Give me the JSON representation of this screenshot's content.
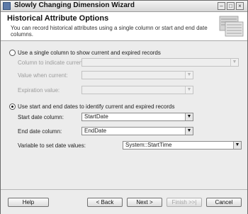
{
  "window": {
    "title": "Slowly Changing Dimension Wizard"
  },
  "header": {
    "title": "Historical Attribute Options",
    "description": "You can record historical attributes using a single column or start and end date columns."
  },
  "option_single": {
    "label": "Use a single column to show current and expired records",
    "selected": false,
    "column_label": "Column to indicate current record:",
    "column_value": "",
    "value_current_label": "Value when current:",
    "value_current_value": "",
    "expiration_label": "Expiration value:",
    "expiration_value": ""
  },
  "option_dates": {
    "label": "Use start and end dates to identify current and expired records",
    "selected": true,
    "start_label": "Start date column:",
    "start_value": "StartDate",
    "end_label": "End date column:",
    "end_value": "EndDate",
    "variable_label": "Variable to set date values:",
    "variable_value": "System::StartTime"
  },
  "buttons": {
    "help": "Help",
    "back": "< Back",
    "next": "Next >",
    "finish": "Finish >>|",
    "cancel": "Cancel"
  },
  "icons": {
    "minimize": "minimize-icon",
    "maximize": "maximize-icon",
    "close": "close-icon",
    "dropdown": "chevron-down-icon"
  },
  "colors": {
    "app_icon": "#5d7aa8",
    "window_bg": "#ececec",
    "header_bg": "#ffffff",
    "disabled_text": "#9c9c9c"
  }
}
